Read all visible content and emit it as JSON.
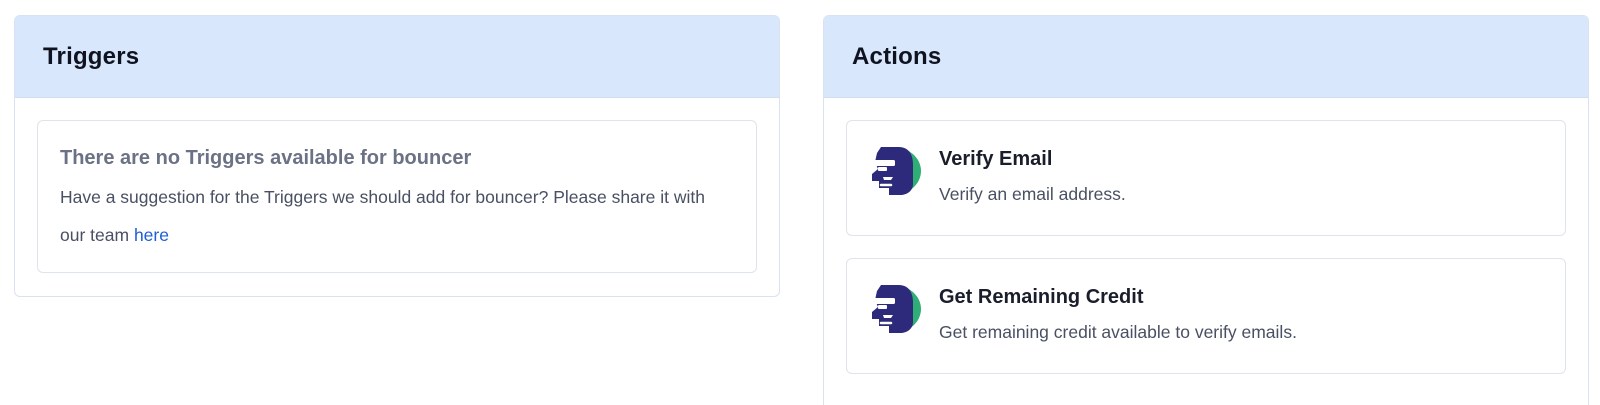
{
  "triggers": {
    "title": "Triggers",
    "empty_title": "There are no Triggers available for bouncer",
    "empty_text": "Have a suggestion for the Triggers we should add for bouncer? Please share it with our team ",
    "empty_link": "here"
  },
  "actions": {
    "title": "Actions",
    "items": [
      {
        "name": "Verify Email",
        "description": "Verify an email address.",
        "icon": "bouncer-logo-icon"
      },
      {
        "name": "Get Remaining Credit",
        "description": "Get remaining credit available to verify emails.",
        "icon": "bouncer-logo-icon"
      }
    ]
  },
  "colors": {
    "header_bg": "#d9e7fd",
    "link": "#1d5fd6",
    "logo_primary": "#2d2a7b",
    "logo_accent": "#2fae76"
  }
}
